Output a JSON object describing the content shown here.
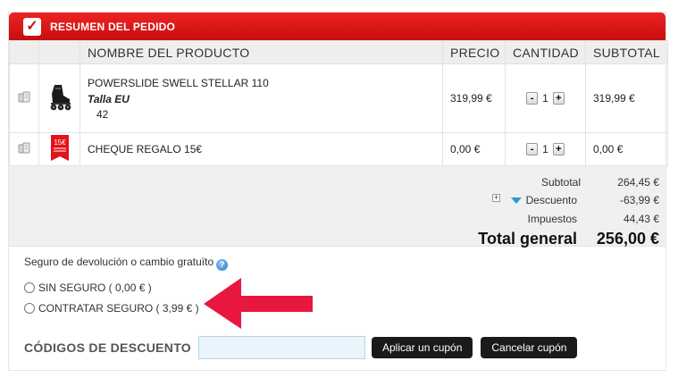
{
  "header": {
    "title": "RESUMEN DEL PEDIDO",
    "check_icon": "checkmark-icon"
  },
  "table": {
    "columns": [
      "NOMBRE DEL PRODUCTO",
      "PRECIO",
      "CANTIDAD",
      "SUBTOTAL"
    ],
    "rows": [
      {
        "name": "POWERSLIDE SWELL STELLAR 110",
        "size_label": "Talla EU",
        "size_value": "42",
        "price": "319,99 €",
        "qty_minus": "-",
        "qty": "1",
        "qty_plus": "+",
        "subtotal": "319,99 €",
        "thumb": "inline-skate-icon"
      },
      {
        "name": "CHEQUE REGALO 15€",
        "price": "0,00 €",
        "qty_minus": "-",
        "qty": "1",
        "qty_plus": "+",
        "subtotal": "0,00 €",
        "thumb": "gift-voucher-icon",
        "thumb_text": "15€"
      }
    ]
  },
  "summary": {
    "subtotal_label": "Subtotal",
    "subtotal_value": "264,45 €",
    "discount_toggle": "+",
    "discount_label": "Descuento",
    "discount_value": "-63,99 €",
    "tax_label": "Impuestos",
    "tax_value": "44,43 €",
    "total_label": "Total general",
    "total_value": "256,00 €"
  },
  "insurance": {
    "title": "Seguro de devolución o cambio gratuïto",
    "help": "?",
    "options": [
      "SIN SEGURO ( 0,00 € )",
      "CONTRATAR SEGURO ( 3,99 € )"
    ]
  },
  "coupon": {
    "label": "CÓDIGOS DE DESCUENTO",
    "input_value": "",
    "apply_button": "Aplicar un cupón",
    "cancel_button": "Cancelar cupón"
  },
  "colors": {
    "accent": "#c80d0d",
    "arrow": "#e8173f"
  }
}
